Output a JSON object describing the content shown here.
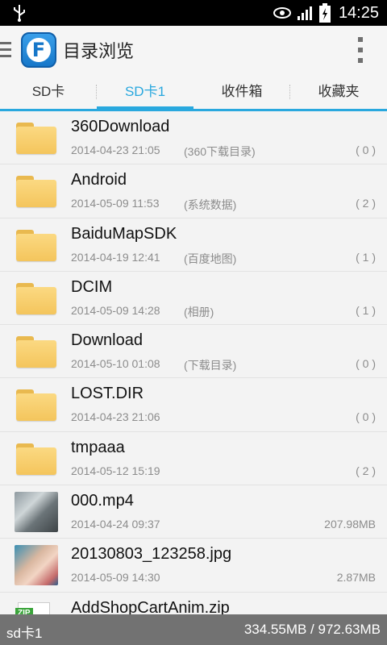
{
  "status_bar": {
    "time": "14:25"
  },
  "app_bar": {
    "title": "目录浏览",
    "logo_letter": "F"
  },
  "tabs": [
    {
      "label": "SD卡",
      "selected": false
    },
    {
      "label": "SD卡1",
      "selected": true
    },
    {
      "label": "收件箱",
      "selected": false
    },
    {
      "label": "收藏夹",
      "selected": false
    }
  ],
  "files": [
    {
      "name": "360Download",
      "date": "2014-04-23 21:05",
      "desc": "(360下载目录)",
      "count": "( 0 )",
      "type": "folder"
    },
    {
      "name": "Android",
      "date": "2014-05-09 11:53",
      "desc": "(系统数据)",
      "count": "( 2 )",
      "type": "folder"
    },
    {
      "name": "BaiduMapSDK",
      "date": "2014-04-19 12:41",
      "desc": "(百度地图)",
      "count": "( 1 )",
      "type": "folder"
    },
    {
      "name": "DCIM",
      "date": "2014-05-09 14:28",
      "desc": "(相册)",
      "count": "( 1 )",
      "type": "folder"
    },
    {
      "name": "Download",
      "date": "2014-05-10 01:08",
      "desc": "(下载目录)",
      "count": "( 0 )",
      "type": "folder"
    },
    {
      "name": "LOST.DIR",
      "date": "2014-04-23 21:06",
      "desc": "",
      "count": "( 0 )",
      "type": "folder"
    },
    {
      "name": "tmpaaa",
      "date": "2014-05-12 15:19",
      "desc": "",
      "count": "( 2 )",
      "type": "folder"
    },
    {
      "name": "000.mp4",
      "date": "2014-04-24 09:37",
      "desc": "",
      "count": "207.98MB",
      "type": "video"
    },
    {
      "name": "20130803_123258.jpg",
      "date": "2014-05-09 14:30",
      "desc": "",
      "count": "2.87MB",
      "type": "image"
    },
    {
      "name": "AddShopCartAnim.zip",
      "date": "",
      "desc": "",
      "count": "",
      "type": "zip",
      "badge": "ZIP"
    }
  ],
  "bottom_bar": {
    "storage_name": "sd卡1",
    "usage": "334.55MB / 972.63MB"
  },
  "colors": {
    "accent": "#29a8de",
    "folder": "#f4c55c",
    "bottom_bar": "#727272"
  }
}
